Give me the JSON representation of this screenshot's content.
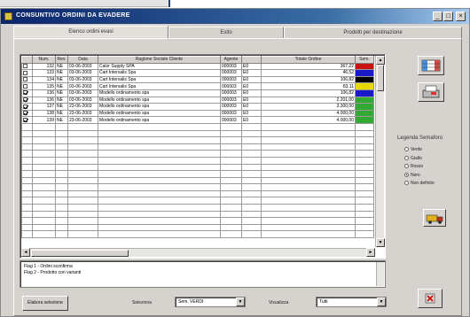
{
  "window": {
    "title": "CONSUNTIVO ORDINI DA EVADERE"
  },
  "tabs": [
    {
      "label": "Elenco ordini evasi"
    },
    {
      "label": "Esito"
    },
    {
      "label": "Prodotti per destinazione"
    }
  ],
  "grid": {
    "columns": [
      "",
      "Num.",
      "Rev.",
      "Data",
      "Ragione Sociale Cliente",
      "Agente",
      "",
      "Totale Ordine",
      "Sem."
    ],
    "rows": [
      {
        "checked": false,
        "num": "132",
        "rev": "NE",
        "date": "03-06-2003",
        "client": "Calor Supply SPA",
        "agent": "000003",
        "ag2": "E0",
        "total": "367,22",
        "color": "#cc1111"
      },
      {
        "checked": false,
        "num": "133",
        "rev": "NE",
        "date": "03-06-2003",
        "client": "Cart Intersalis Spa",
        "agent": "000003",
        "ag2": "E0",
        "total": "46,52",
        "color": "#1a1acc"
      },
      {
        "checked": false,
        "num": "134",
        "rev": "NE",
        "date": "03-06-2003",
        "client": "Cart Intersalis Spa",
        "agent": "000003",
        "ag2": "E0",
        "total": "106,82",
        "color": "#000000"
      },
      {
        "checked": false,
        "num": "135",
        "rev": "NE",
        "date": "03-06-2003",
        "client": "Cart Intersalis Spa",
        "agent": "000003",
        "ag2": "E0",
        "total": "83,11",
        "color": "#e8d800"
      },
      {
        "checked": true,
        "num": "136",
        "rev": "NE",
        "date": "03-06-2003",
        "client": "Modello ordinamento spa",
        "agent": "000003",
        "ag2": "E0",
        "total": "106,82",
        "color": "#1a1acc"
      },
      {
        "checked": true,
        "num": "136",
        "rev": "NE",
        "date": "03-06-2003",
        "client": "Modello ordinamento spa",
        "agent": "000003",
        "ag2": "E0",
        "total": "2.201,00",
        "color": "#33aa33"
      },
      {
        "checked": true,
        "num": "137",
        "rev": "NE",
        "date": "23-06-2003",
        "client": "Modello ordinamento spa",
        "agent": "000003",
        "ag2": "E0",
        "total": "3.300,00",
        "color": "#33aa33"
      },
      {
        "checked": true,
        "num": "138",
        "rev": "NE",
        "date": "23-06-2003",
        "client": "Modello ordinamento spa",
        "agent": "000003",
        "ag2": "E0",
        "total": "4.000,00",
        "color": "#33aa33"
      },
      {
        "checked": true,
        "num": "139",
        "rev": "NE",
        "date": "23-06-2003",
        "client": "Modello ordinamento spa",
        "agent": "000003",
        "ag2": "E0",
        "total": "4.000,00",
        "color": "#33aa33"
      }
    ],
    "empty_rows": 17
  },
  "notes": {
    "line1": "Flag 1 - Ordini sconfirma",
    "line2": "Flag 2 - Prodotto con varianti"
  },
  "legend": {
    "title": "Legenda Semaforo",
    "items": [
      {
        "label": "Verde",
        "selected": false
      },
      {
        "label": "Giallo",
        "selected": false
      },
      {
        "label": "Rosso",
        "selected": false
      },
      {
        "label": "Nero",
        "selected": true
      },
      {
        "label": "Non definito",
        "selected": false
      }
    ]
  },
  "bottom": {
    "action_button": "Elabora selezione",
    "filter_label": "Seleziona",
    "filter_value": "Sem. VERDI",
    "order_label": "Visualizza",
    "order_value": "Tutti"
  }
}
